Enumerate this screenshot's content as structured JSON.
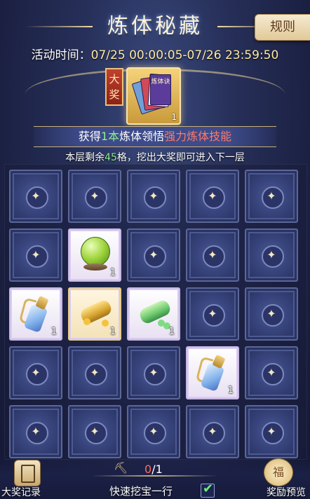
{
  "header": {
    "title": "炼体秘藏",
    "rules_label": "规则",
    "time_label": "活动时间：",
    "time_value": "07/25 00:00:05-07/26 23:59:50"
  },
  "grand_prize": {
    "tag": "大奖",
    "book_text": "炼体诀",
    "count": "1",
    "icon": "skill-book-icon"
  },
  "banner": {
    "prefix": "获得",
    "qty": "1本",
    "middle": "炼体领悟",
    "highlight": "强力炼体技能"
  },
  "layer_info": {
    "prefix": "本层剩余",
    "remaining": "45",
    "suffix": "格，挖出大奖即可进入下一层"
  },
  "grid": {
    "rows": 5,
    "cols": 5,
    "cells": [
      [
        "covered",
        "covered",
        "covered",
        "covered",
        "covered"
      ],
      [
        "covered",
        "orb",
        "covered",
        "covered",
        "covered"
      ],
      [
        "flask",
        "gold-log",
        "green-log",
        "covered",
        "covered"
      ],
      [
        "covered",
        "covered",
        "covered",
        "flask",
        "covered"
      ],
      [
        "covered",
        "covered",
        "covered",
        "covered",
        "covered"
      ]
    ],
    "item_count": "1"
  },
  "footer": {
    "record_label": "大奖记录",
    "preview_label": "奖励预览",
    "progress_used": "0",
    "progress_total": "/1",
    "quick_dig_label": "快速挖宝一行",
    "quick_dig_checked": true
  }
}
